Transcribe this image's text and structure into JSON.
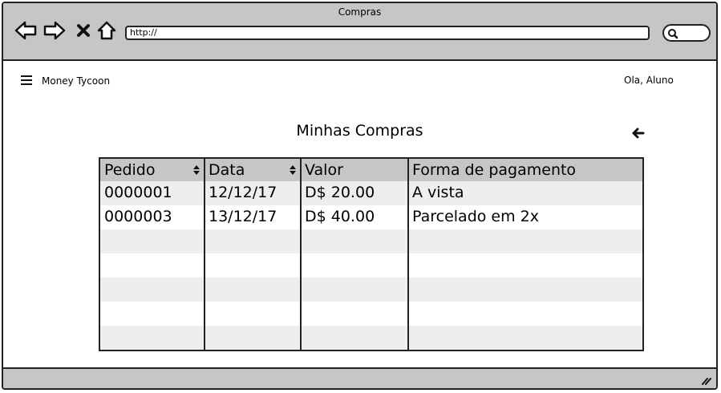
{
  "window": {
    "title": "Compras"
  },
  "browser": {
    "url": "http://"
  },
  "header": {
    "app_name": "Money Tycoon",
    "user_greeting": "Ola, Aluno"
  },
  "main": {
    "title": "Minhas Compras",
    "table": {
      "columns": [
        "Pedido",
        "Data",
        "Valor",
        "Forma de pagamento"
      ],
      "rows": [
        [
          "0000001",
          "12/12/17",
          "D$ 20.00",
          "A vista"
        ],
        [
          "0000003",
          "13/12/17",
          "D$ 40.00",
          "Parcelado em 2x"
        ]
      ],
      "empty_rows": 5
    }
  },
  "icons": [
    "back-arrow-icon",
    "forward-arrow-icon",
    "close-icon",
    "home-icon",
    "search-icon",
    "hamburger-menu-icon",
    "back-icon",
    "sort-icon",
    "resize-grip-icon"
  ],
  "colors": {
    "chrome": "#c6c6c6",
    "row_alt": "#eeeeee",
    "border": "#222222"
  }
}
